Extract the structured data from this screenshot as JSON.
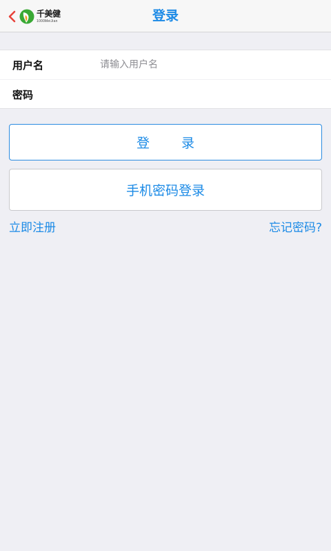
{
  "header": {
    "title": "登录",
    "logo_name": "千美健",
    "logo_sub": "1000MeiJian"
  },
  "form": {
    "username_label": "用户名",
    "username_placeholder": "请输入用户名",
    "username_value": "",
    "password_label": "密码",
    "password_value": ""
  },
  "actions": {
    "login_label": "登 录",
    "phone_login_label": "手机密码登录",
    "register_label": "立即注册",
    "forgot_label": "忘记密码?"
  },
  "colors": {
    "accent": "#1b8ae6",
    "background": "#efeff4",
    "back_chevron": "#e8433b",
    "logo_green": "#3aa935",
    "logo_orange": "#f29c1f"
  },
  "icons": {
    "back": "chevron-left-icon",
    "logo": "leaf-logo-icon"
  }
}
